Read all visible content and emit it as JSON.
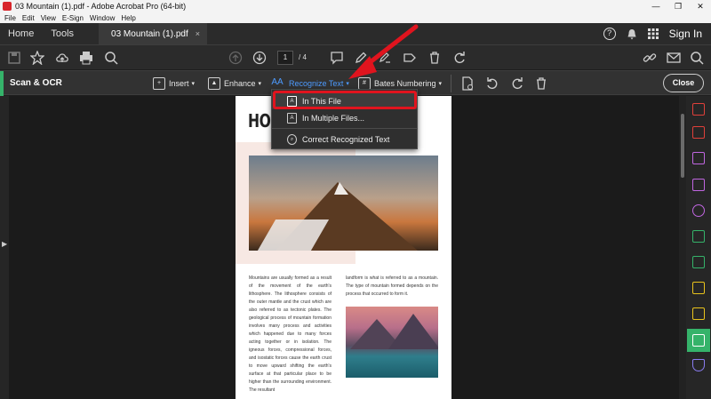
{
  "window": {
    "title": "03 Mountain (1).pdf - Adobe Acrobat Pro (64-bit)",
    "minimize": "—",
    "maximize": "❐",
    "close": "✕"
  },
  "menu": [
    "File",
    "Edit",
    "View",
    "E-Sign",
    "Window",
    "Help"
  ],
  "tabs": {
    "home": "Home",
    "tools": "Tools",
    "document": "03 Mountain (1).pdf",
    "document_close": "×",
    "signin": "Sign In",
    "help": "?"
  },
  "toolbar": {
    "page_current": "1",
    "page_total": "/ 4"
  },
  "scan_ocr": {
    "title": "Scan & OCR",
    "items": [
      {
        "label": "Insert"
      },
      {
        "label": "Enhance"
      },
      {
        "label": "Recognize Text"
      },
      {
        "label": "Bates Numbering"
      }
    ],
    "close": "Close"
  },
  "dropdown": {
    "items": [
      {
        "label": "In This File"
      },
      {
        "label": "In Multiple Files..."
      },
      {
        "label": "Correct Recognized Text"
      }
    ]
  },
  "document": {
    "heading": "HOW              ED?",
    "col1": "Mountains are usually formed as a result of the movement of the earth's lithosphere. The lithosphere consists of the outer mantle and the crust which are also referred to as tectonic plates. The geological process of mountain formation involves many process and activities which happened due to many forces acting together or in isolation. The igneous forces, compressional forces, and isostatic forces cause the earth crust to move upward shifting the earth's surface at that particular place to be higher than the surrounding environment. The resultant",
    "col2": "landform is what is referred to as a mountain. The type of mountain formed depends on the process that occurred to form it."
  },
  "colors": {
    "accent_green": "#35b36a",
    "highlight_red": "#e0141e",
    "link_blue": "#4d9bff"
  }
}
